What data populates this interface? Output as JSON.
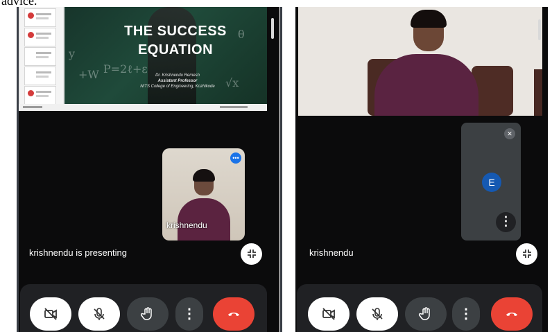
{
  "caption": "advice.",
  "left": {
    "slide": {
      "title_line1": "THE SUCCESS",
      "title_line2": "EQUATION",
      "author": "Dr. Krishnendu Remesh",
      "role": "Assistant Professor",
      "college": "NITS College of Engineering, Kozhikode"
    },
    "self_name": "krishnendu",
    "presenting_label": "krishnendu is presenting",
    "shrink_icon": "shrink-arrows-icon",
    "controls": {
      "camera": "camera-off-icon",
      "mic": "mic-off-icon",
      "hand": "raise-hand-icon",
      "more": "more-vert-icon",
      "end": "end-call-icon"
    }
  },
  "right": {
    "tile_avatar_letter": "E",
    "main_name": "krishnendu",
    "shrink_icon": "shrink-arrows-icon",
    "controls": {
      "camera": "camera-off-icon",
      "mic": "mic-off-icon",
      "hand": "raise-hand-icon",
      "more": "more-vert-icon",
      "end": "end-call-icon"
    }
  },
  "colors": {
    "end_call": "#ea4335",
    "control_bar": "#202124",
    "avatar": "#1559b2",
    "accent": "#1a73e8"
  }
}
